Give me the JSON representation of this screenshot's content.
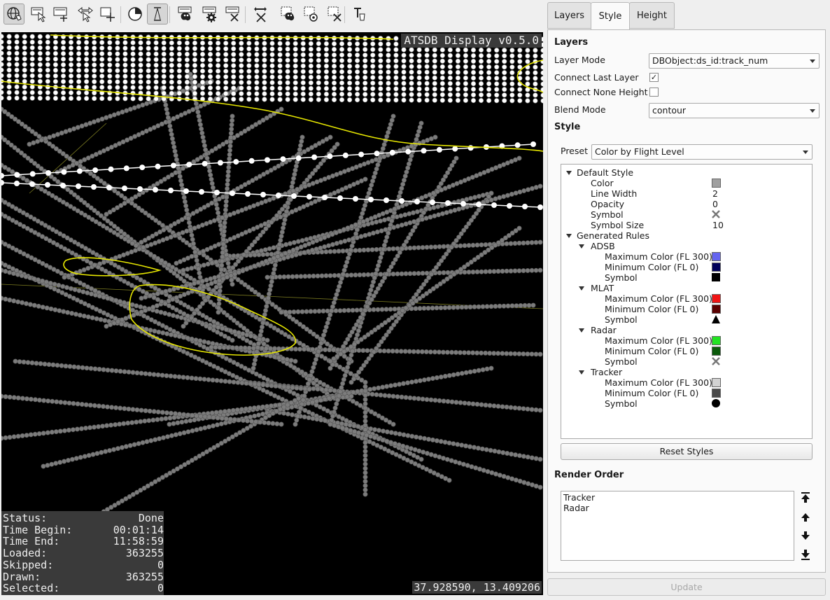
{
  "toolbar": {
    "buttons": [
      {
        "name": "navigate-globe-button",
        "icon": "globe-hand-icon",
        "active": true
      },
      {
        "name": "select-button",
        "icon": "cursor-select-icon",
        "active": false
      },
      {
        "name": "add-rect-button",
        "icon": "rect-plus-icon",
        "active": false
      },
      {
        "name": "move-button",
        "icon": "arrows-cursor-icon",
        "active": false
      },
      {
        "name": "add-point-button",
        "icon": "crosshair-plus-icon",
        "active": false
      },
      {
        "name": "time-filter-button",
        "icon": "clock-icon",
        "active": false
      },
      {
        "name": "height-filter-button",
        "icon": "height-range-icon",
        "active": true
      },
      {
        "name": "style-button",
        "icon": "palette-icon",
        "active": false
      },
      {
        "name": "settings-button",
        "icon": "gear-icon",
        "active": false
      },
      {
        "name": "clear-button",
        "icon": "clear-x-icon",
        "active": false
      },
      {
        "name": "zoom-fit-button",
        "icon": "zoom-fit-icon",
        "active": false
      },
      {
        "name": "select-style-button",
        "icon": "selection-palette-icon",
        "active": false
      },
      {
        "name": "select-settings-button",
        "icon": "selection-gear-icon",
        "active": false
      },
      {
        "name": "clear-selection-button",
        "icon": "selection-x-icon",
        "active": false
      },
      {
        "name": "text-tool-button",
        "icon": "text-tool-icon",
        "active": false
      }
    ]
  },
  "map": {
    "overlay_title": "ATSDB Display v0.5.0",
    "status": [
      {
        "key": "Status:",
        "value": "Done"
      },
      {
        "key": "Time Begin:",
        "value": "00:01:14"
      },
      {
        "key": "Time End:",
        "value": "11:58:59"
      },
      {
        "key": "Loaded:",
        "value": "363255"
      },
      {
        "key": "Skipped:",
        "value": "0"
      },
      {
        "key": "Drawn:",
        "value": "363255"
      },
      {
        "key": "Selected:",
        "value": "0"
      }
    ],
    "coordinates": "37.928590, 13.409206"
  },
  "tabs": [
    {
      "label": "Layers",
      "active": false
    },
    {
      "label": "Style",
      "active": true
    },
    {
      "label": "Height",
      "active": false
    }
  ],
  "layers": {
    "heading": "Layers",
    "layer_mode_label": "Layer Mode",
    "layer_mode_value": "DBObject:ds_id:track_num",
    "connect_last_label": "Connect Last Layer",
    "connect_last_checked": true,
    "connect_none_label": "Connect None Height",
    "connect_none_checked": false,
    "blend_mode_label": "Blend Mode",
    "blend_mode_value": "contour"
  },
  "style": {
    "heading": "Style",
    "preset_label": "Preset",
    "preset_value": "Color by Flight Level",
    "tree": {
      "default_style": {
        "label": "Default Style",
        "rows": [
          {
            "label": "Color",
            "kind": "swatch",
            "color": "#a0a0a0"
          },
          {
            "label": "Line Width",
            "kind": "text",
            "value": "2"
          },
          {
            "label": "Opacity",
            "kind": "text",
            "value": "0"
          },
          {
            "label": "Symbol",
            "kind": "symbol",
            "icon": "x-cross-icon"
          },
          {
            "label": "Symbol Size",
            "kind": "text",
            "value": "10"
          }
        ]
      },
      "generated_rules": {
        "label": "Generated Rules",
        "groups": [
          {
            "label": "ADSB",
            "rows": [
              {
                "label": "Maximum Color (FL 300)",
                "kind": "swatch",
                "color": "#6464f0"
              },
              {
                "label": "Minimum Color (FL 0)",
                "kind": "swatch",
                "color": "#00005a"
              },
              {
                "label": "Symbol",
                "kind": "symbol",
                "icon": "square-icon"
              }
            ]
          },
          {
            "label": "MLAT",
            "rows": [
              {
                "label": "Maximum Color (FL 300)",
                "kind": "swatch",
                "color": "#f01414"
              },
              {
                "label": "Minimum Color (FL 0)",
                "kind": "swatch",
                "color": "#5a0000"
              },
              {
                "label": "Symbol",
                "kind": "symbol",
                "icon": "triangle-icon"
              }
            ]
          },
          {
            "label": "Radar",
            "rows": [
              {
                "label": "Maximum Color (FL 300)",
                "kind": "swatch",
                "color": "#22e322"
              },
              {
                "label": "Minimum Color (FL 0)",
                "kind": "swatch",
                "color": "#0b5a0b"
              },
              {
                "label": "Symbol",
                "kind": "symbol",
                "icon": "x-cross-icon"
              }
            ]
          },
          {
            "label": "Tracker",
            "rows": [
              {
                "label": "Maximum Color (FL 300)",
                "kind": "swatch",
                "color": "#d2d2d2"
              },
              {
                "label": "Minimum Color (FL 0)",
                "kind": "swatch",
                "color": "#4a4a4a"
              },
              {
                "label": "Symbol",
                "kind": "symbol",
                "icon": "circle-icon"
              }
            ]
          }
        ]
      }
    },
    "reset_label": "Reset Styles"
  },
  "render_order": {
    "heading": "Render Order",
    "items": [
      "Tracker",
      "Radar"
    ]
  },
  "update_label": "Update"
}
